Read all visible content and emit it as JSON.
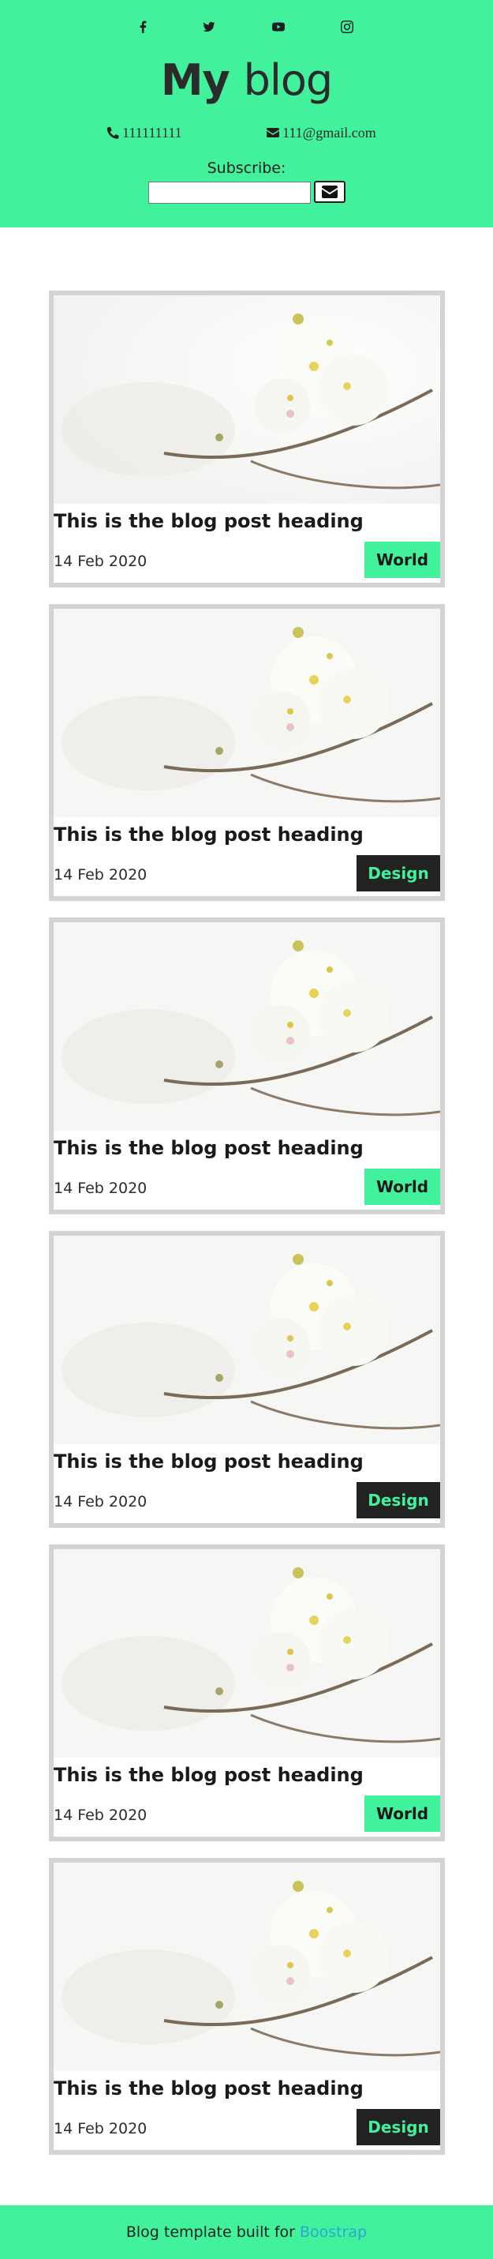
{
  "header": {
    "title_bold": "My",
    "title_rest": "blog",
    "phone": "111111111",
    "email": "111@gmail.com",
    "subscribe_label": "Subscribe:",
    "subscribe_placeholder": "",
    "socials": [
      "facebook-icon",
      "twitter-icon",
      "youtube-icon",
      "instagram-icon"
    ]
  },
  "posts": [
    {
      "heading": "This is the blog post heading",
      "date": "14 Feb 2020",
      "tag": "World"
    },
    {
      "heading": "This is the blog post heading",
      "date": "14 Feb 2020",
      "tag": "Design"
    },
    {
      "heading": "This is the blog post heading",
      "date": "14 Feb 2020",
      "tag": "World"
    },
    {
      "heading": "This is the blog post heading",
      "date": "14 Feb 2020",
      "tag": "Design"
    },
    {
      "heading": "This is the blog post heading",
      "date": "14 Feb 2020",
      "tag": "World"
    },
    {
      "heading": "This is the blog post heading",
      "date": "14 Feb 2020",
      "tag": "Design"
    }
  ],
  "footer": {
    "text": "Blog template built for",
    "link": "Boostrap"
  },
  "colors": {
    "accent": "#42f19b",
    "dark": "#222222",
    "link": "#2aa7d8",
    "card_border": "#d3d3d3"
  }
}
